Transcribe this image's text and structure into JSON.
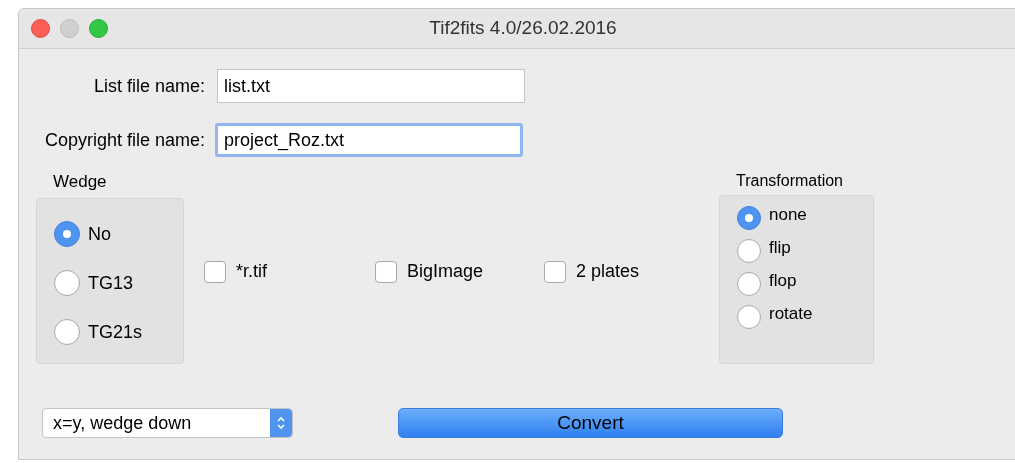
{
  "window": {
    "title": "Tif2fits 4.0/26.02.2016"
  },
  "fields": [
    {
      "label": "List file name:",
      "value": "list.txt",
      "focused": false
    },
    {
      "label": "Copyright file name:",
      "value": "project_Roz.txt",
      "focused": true
    }
  ],
  "wedge": {
    "title": "Wedge",
    "options": [
      {
        "label": "No",
        "selected": true
      },
      {
        "label": "TG13",
        "selected": false
      },
      {
        "label": "TG21s",
        "selected": false
      }
    ]
  },
  "checkboxes": [
    {
      "label": "*r.tif",
      "checked": false
    },
    {
      "label": "BigImage",
      "checked": false
    },
    {
      "label": "2 plates",
      "checked": false
    }
  ],
  "transformation": {
    "title": "Transformation",
    "options": [
      {
        "label": "none",
        "selected": true
      },
      {
        "label": "flip",
        "selected": false
      },
      {
        "label": "flop",
        "selected": false
      },
      {
        "label": "rotate",
        "selected": false
      }
    ]
  },
  "mode_select": {
    "value": "x=y, wedge down"
  },
  "convert_button": {
    "label": "Convert"
  }
}
